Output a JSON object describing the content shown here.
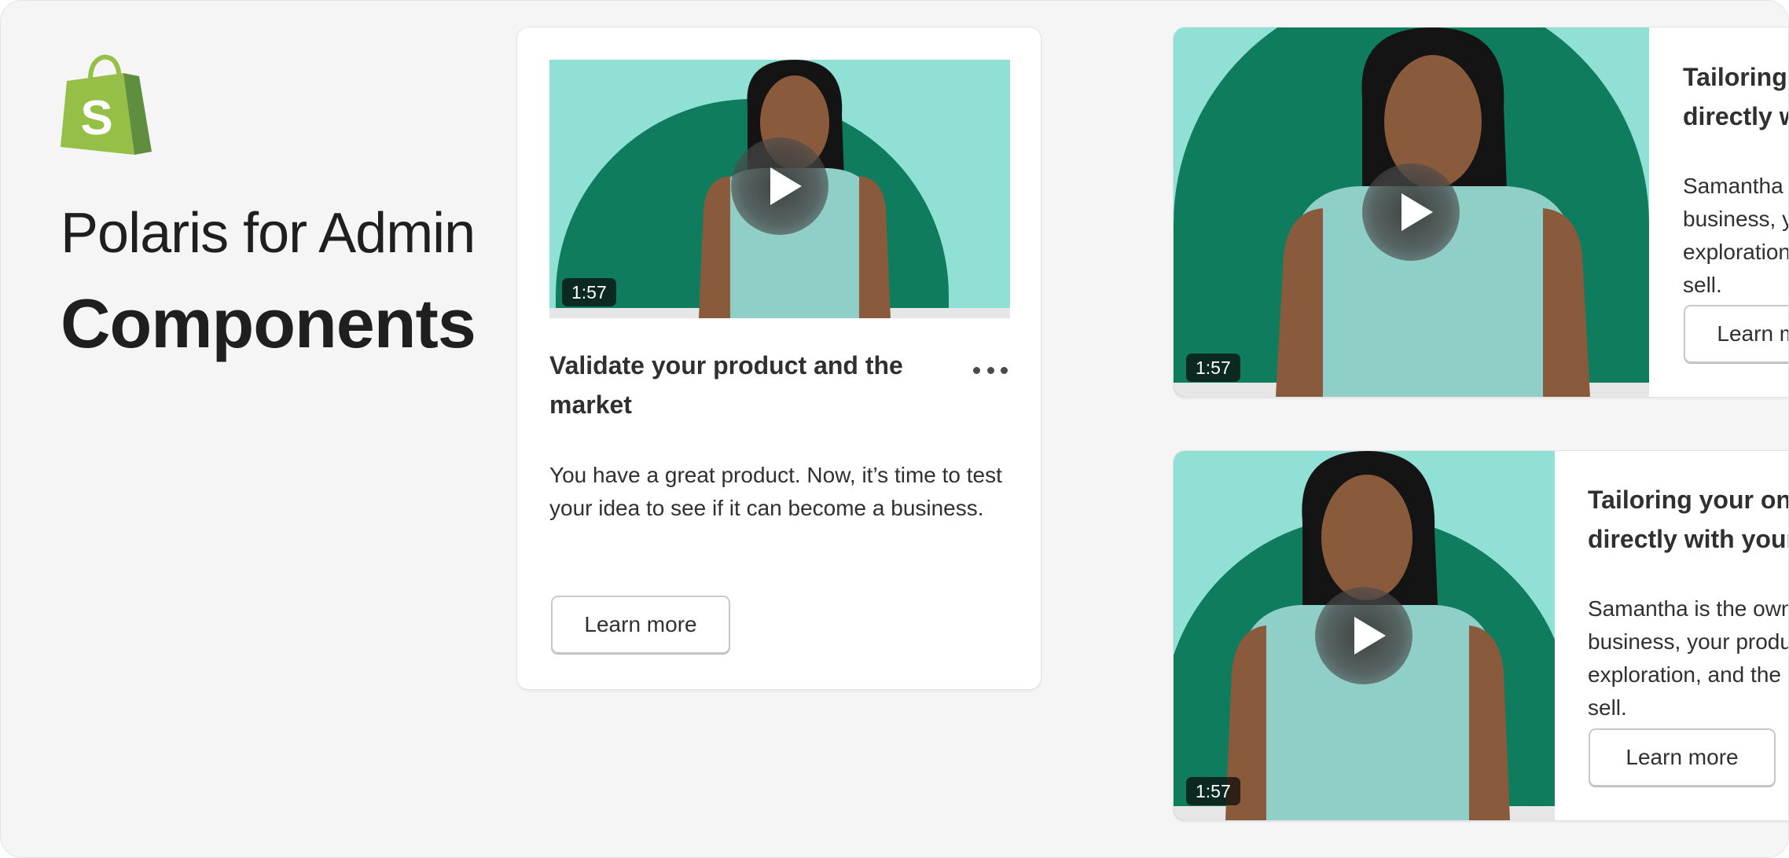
{
  "brand": {
    "logo_icon": "shopify-bag-icon",
    "logo_letter": "S",
    "colors": {
      "bag_light": "#95bf47",
      "bag_dark": "#5e8e3e"
    }
  },
  "heading": {
    "subtitle": "Polaris for Admin",
    "title": "Components"
  },
  "cards": [
    {
      "duration": "1:57",
      "title": "Validate your product and the market",
      "description": "You have a great product. Now, it’s time to test your idea to see if it can become a business.",
      "button_label": "Learn more",
      "menu_icon": "more-horizontal-icon"
    },
    {
      "duration": "1:57",
      "title": "Tailoring your online store directly with your customers",
      "description": "Samantha is the owner of a business, your product exploration, and the products to sell.",
      "button_label": "Learn more"
    },
    {
      "duration": "1:57",
      "title": "Tailoring your online store directly with your customers",
      "description": "Samantha is the owner of a business, your product exploration, and the products to sell.",
      "button_label": "Learn more"
    }
  ],
  "theme": {
    "video_bg": "#90e0d6",
    "video_arch": "#0f7c5e",
    "page_bg": "#f5f5f5"
  }
}
